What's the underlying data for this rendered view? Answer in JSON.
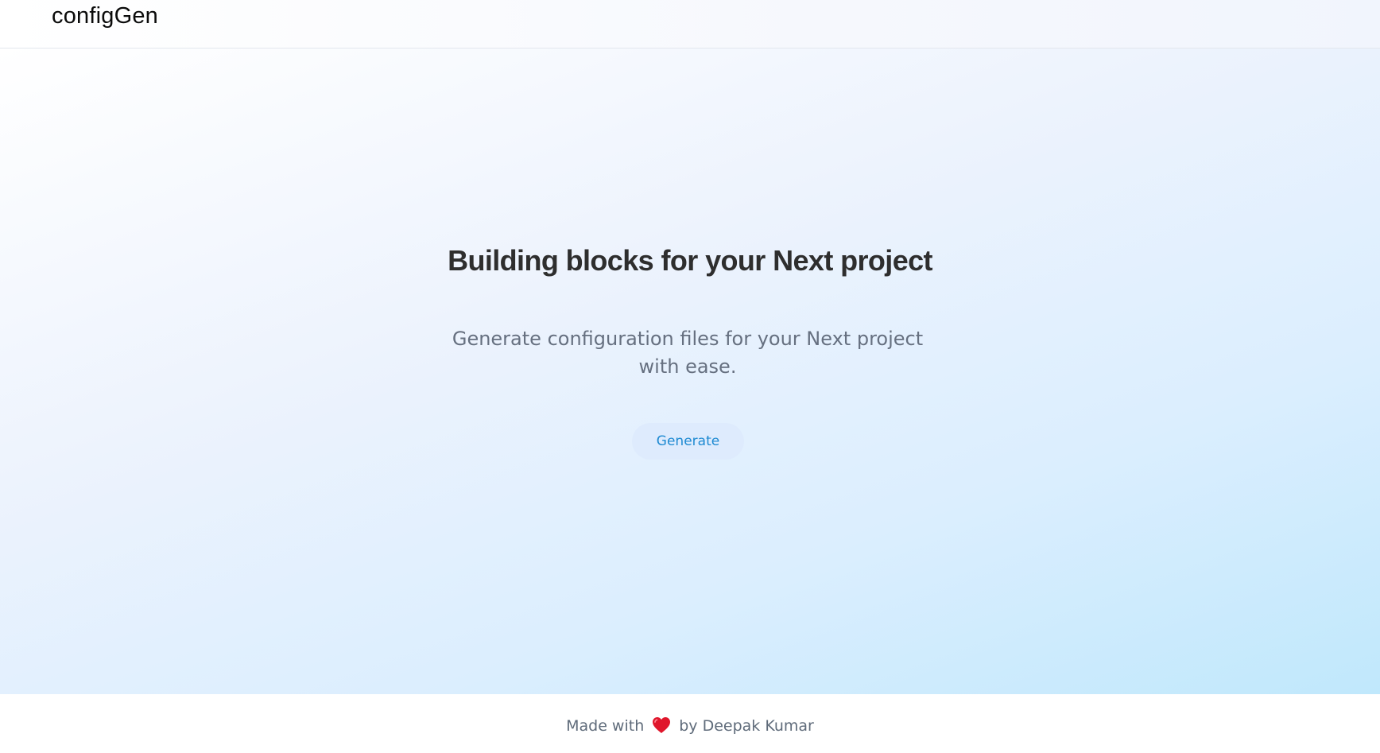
{
  "header": {
    "brand": "configGen"
  },
  "hero": {
    "title": "Building blocks for your Next project",
    "subtitle": "Generate configuration files for your Next project with ease.",
    "cta_label": "Generate"
  },
  "footer": {
    "prefix": "Made with",
    "icon": "heart-icon",
    "suffix": "by Deepak Kumar"
  },
  "colors": {
    "heart": "#e0162b",
    "cta_text": "#1e8ad2",
    "cta_bg": "#deebfd"
  }
}
